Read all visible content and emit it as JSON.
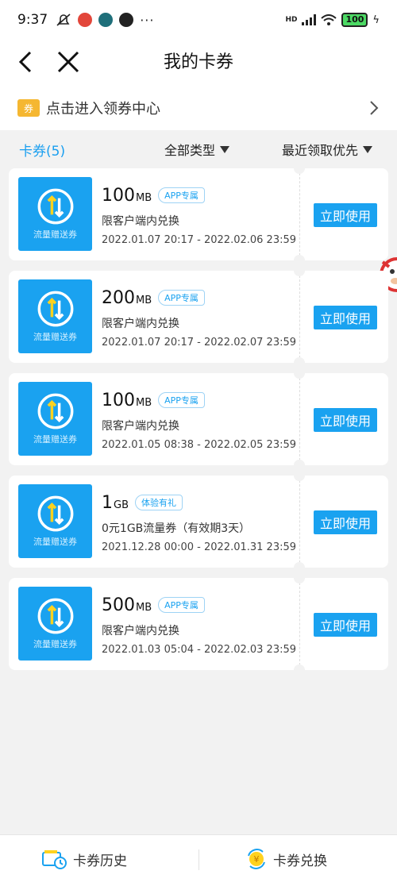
{
  "status_bar": {
    "time": "9:37",
    "network": "HD",
    "battery": "100"
  },
  "nav": {
    "title": "我的卡券"
  },
  "center_entry": {
    "tag": "券",
    "label": "点击进入领券中心"
  },
  "filter": {
    "count_label": "卡券(5)",
    "type_label": "全部类型",
    "sort_label": "最近领取优先"
  },
  "coupons": [
    {
      "amount": "100",
      "unit": "MB",
      "tag": "APP专属",
      "desc": "限客户端内兑换",
      "date": "2022.01.07 20:17 - 2022.02.06 23:59",
      "icon_label": "流量赠送券",
      "button": "立即使用"
    },
    {
      "amount": "200",
      "unit": "MB",
      "tag": "APP专属",
      "desc": "限客户端内兑换",
      "date": "2022.01.07 20:17 - 2022.02.07 23:59",
      "icon_label": "流量赠送券",
      "button": "立即使用"
    },
    {
      "amount": "100",
      "unit": "MB",
      "tag": "APP专属",
      "desc": "限客户端内兑换",
      "date": "2022.01.05 08:38 - 2022.02.05 23:59",
      "icon_label": "流量赠送券",
      "button": "立即使用"
    },
    {
      "amount": "1",
      "unit": "GB",
      "tag": "体验有礼",
      "desc": "0元1GB流量券（有效期3天）",
      "date": "2021.12.28 00:00 - 2022.01.31 23:59",
      "icon_label": "流量赠送券",
      "button": "立即使用"
    },
    {
      "amount": "500",
      "unit": "MB",
      "tag": "APP专属",
      "desc": "限客户端内兑换",
      "date": "2022.01.03 05:04 - 2022.02.03 23:59",
      "icon_label": "流量赠送券",
      "button": "立即使用"
    }
  ],
  "bottom_bar": {
    "history_label": "卡券历史",
    "exchange_label": "卡券兑换"
  },
  "colors": {
    "accent": "#1aa2f0",
    "ticket_tag": "#f5b731",
    "page_bg": "#f2f2f2"
  },
  "icons": {
    "back": "chevron-left-icon",
    "close": "close-icon",
    "center_chevron": "chevron-right-icon",
    "coupon": "data-transfer-icon",
    "history": "wallet-clock-icon",
    "exchange": "exchange-coin-icon"
  }
}
